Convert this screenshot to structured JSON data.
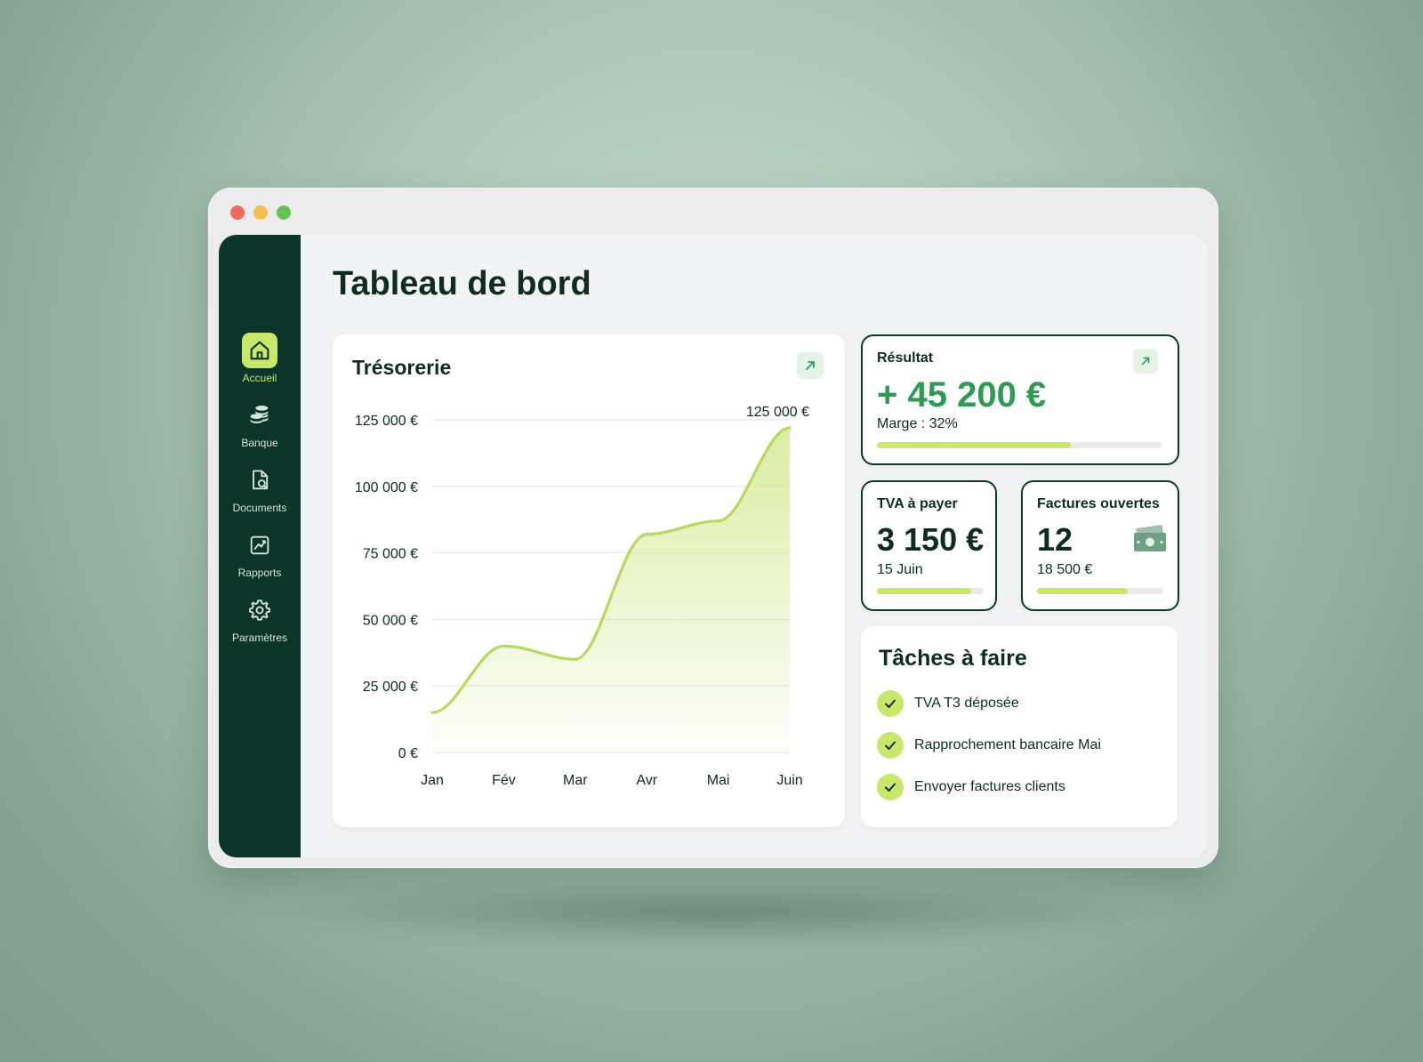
{
  "page": {
    "title": "Tableau de bord"
  },
  "sidebar": {
    "items": [
      {
        "label": "Accueil",
        "icon": "home-icon",
        "active": true
      },
      {
        "label": "Banque",
        "icon": "coins-icon"
      },
      {
        "label": "Documents",
        "icon": "document-search-icon"
      },
      {
        "label": "Rapports",
        "icon": "chart-icon"
      },
      {
        "label": "Paramètres",
        "icon": "gear-icon"
      }
    ]
  },
  "treasury": {
    "title": "Trésorerie",
    "peak_label": "125 000 €"
  },
  "chart_data": {
    "type": "area",
    "title": "Trésorerie",
    "x": [
      "Jan",
      "Fév",
      "Mar",
      "Avr",
      "Mai",
      "Juin"
    ],
    "series": [
      {
        "values": [
          15000,
          40000,
          35000,
          82000,
          87000,
          122000
        ]
      }
    ],
    "y_ticks": [
      0,
      25000,
      50000,
      75000,
      100000,
      125000
    ],
    "y_tick_labels": [
      "0 €",
      "25 000 €",
      "50 000 €",
      "75 000 €",
      "100 000 €",
      "125 000 €"
    ],
    "ylim": [
      0,
      125000
    ],
    "grid": true,
    "annotation": "125 000 €",
    "colors": {
      "line": "#b7d95f",
      "fill": "#d9ec9e"
    }
  },
  "result": {
    "label": "Résultat",
    "value": "+ 45 200 €",
    "margin": "Marge : 32%",
    "progress": 0.68
  },
  "tva": {
    "label": "TVA à payer",
    "value": "3 150 €",
    "due": "15 Juin",
    "progress": 0.88
  },
  "invoices": {
    "label": "Factures ouvertes",
    "count": "12",
    "amount": "18 500 €",
    "progress": 0.72,
    "icon": "banknote-icon"
  },
  "tasks": {
    "title": "Tâches à faire",
    "items": [
      "TVA T3 déposée",
      "Rapprochement bancaire Mai",
      "Envoyer factures clients"
    ]
  },
  "colors": {
    "sidebar": "#0b3528",
    "accent": "#c7e86a",
    "positive": "#2f9a54",
    "text": "#0e2c22"
  }
}
